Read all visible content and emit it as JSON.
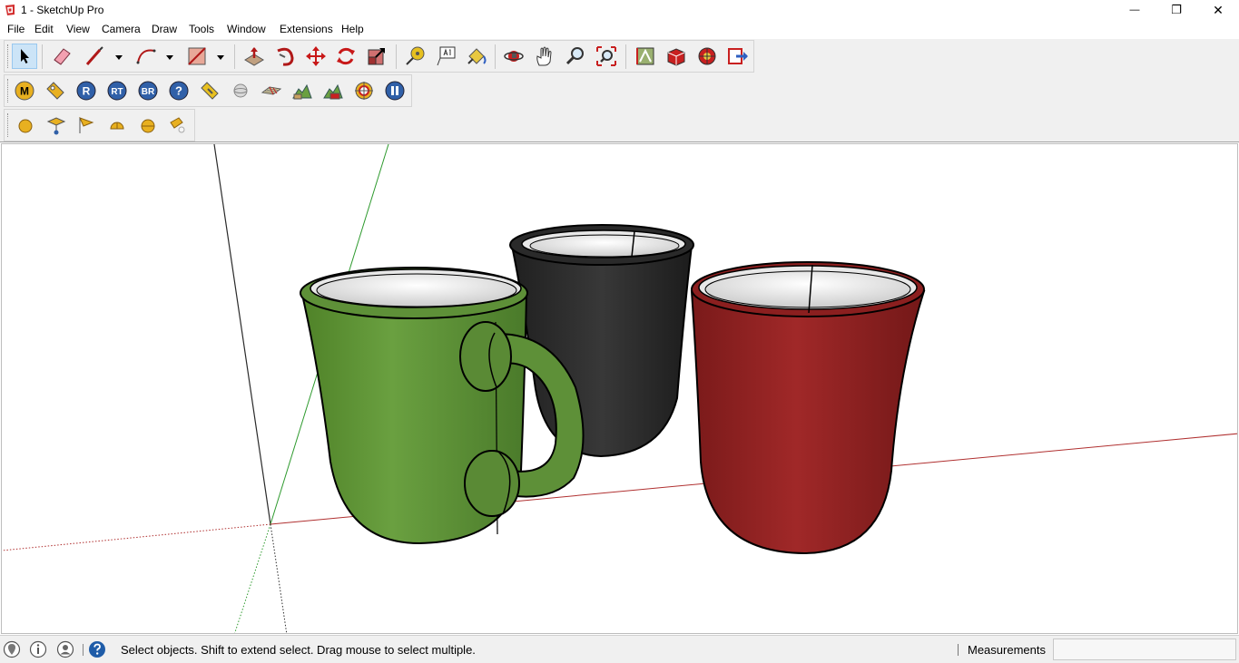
{
  "window": {
    "title": "1 - SketchUp Pro",
    "minimize_glyph": "—",
    "restore_glyph": "❐",
    "close_glyph": "✕"
  },
  "menu": [
    "File",
    "Edit",
    "View",
    "Camera",
    "Draw",
    "Tools",
    "Window",
    "Extensions",
    "Help"
  ],
  "toolbars": {
    "extension_toolbar_letters": {
      "m": "M",
      "r": "R",
      "rt": "RT",
      "br": "BR",
      "help": "?"
    }
  },
  "icons": {
    "main": [
      "select-icon",
      "eraser-icon",
      "line-icon",
      "arc-icon",
      "rectangle-icon",
      "push-pull-icon",
      "follow-me-icon",
      "move-icon",
      "rotate-icon",
      "scale-icon",
      "tape-measure-icon",
      "text-icon",
      "paint-bucket-icon",
      "orbit-icon",
      "pan-icon",
      "zoom-icon",
      "zoom-extents-icon",
      "3d-warehouse-icon",
      "extension-warehouse-icon",
      "layout-icon",
      "send-to-layout-icon"
    ],
    "status": [
      "geo-location-icon",
      "credits-icon",
      "user-icon",
      "help-icon"
    ]
  },
  "scene": {
    "objects": [
      "green-mug",
      "black-cup",
      "red-cup"
    ],
    "colors": {
      "green": "#5e9038",
      "black": "#2a2a2a",
      "red": "#8b1f1f",
      "red_axis": "#b03030",
      "green_axis": "#2e9a2e",
      "blue_axis": "#2a2a2a"
    }
  },
  "status": {
    "message": "Select objects. Shift to extend select. Drag mouse to select multiple.",
    "measurements_label": "Measurements",
    "measurements_value": ""
  }
}
